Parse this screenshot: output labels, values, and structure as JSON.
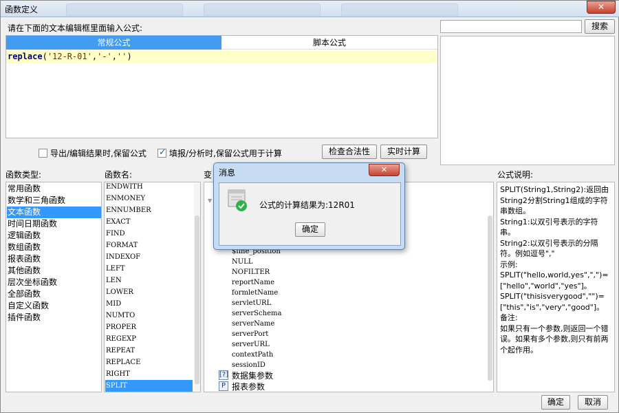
{
  "window": {
    "title": "函数定义",
    "close_glyph": "✕"
  },
  "top": {
    "prompt_label": "请在下面的文本编辑框里面输入公式:",
    "search": {
      "value": "",
      "button_label": "搜索"
    },
    "tabs": [
      {
        "label": "常规公式",
        "active": true
      },
      {
        "label": "脚本公式",
        "active": false
      }
    ],
    "formula": {
      "fn": "replace",
      "open": "(",
      "arg1": "'12-R-01'",
      "comma1": ",",
      "arg2": "'-'",
      "comma2": ",",
      "arg3": "''",
      "close": ")"
    },
    "options": [
      {
        "label": "导出/编辑结果时,保留公式",
        "checked": false
      },
      {
        "label": "填报/分析时,保留公式用于计算",
        "checked": true
      }
    ],
    "check_validity_label": "检查合法性",
    "realtime_calc_label": "实时计算"
  },
  "labels": {
    "types": "函数类型:",
    "names": "函数名:",
    "vars": "变",
    "desc": "公式说明:"
  },
  "function_types": [
    "常用函数",
    "数学和三角函数",
    "文本函数",
    "时间日期函数",
    "逻辑函数",
    "数组函数",
    "报表函数",
    "其他函数",
    "层次坐标函数",
    "全部函数",
    "自定义函数",
    "插件函数"
  ],
  "selected_type_index": 2,
  "function_names": [
    "ENDWITH",
    "ENMONEY",
    "ENNUMBER",
    "EXACT",
    "FIND",
    "FORMAT",
    "INDEXOF",
    "LEFT",
    "LEN",
    "LOWER",
    "MID",
    "NUMTO",
    "PROPER",
    "REGEXP",
    "REPEAT",
    "REPLACE",
    "RIGHT",
    "SPLIT"
  ],
  "selected_name_index": 17,
  "variables": {
    "expander_glyph": "▼",
    "partial_item": "$fine_position",
    "items": [
      "NULL",
      "NOFILTER",
      "reportName",
      "formletName",
      "servletURL",
      "serverSchema",
      "serverName",
      "serverPort",
      "serverURL",
      "contextPath",
      "sessionID"
    ],
    "groups": [
      {
        "icon_text": "[?]",
        "label": "数据集参数"
      },
      {
        "icon_text": "P",
        "label": "报表参数"
      }
    ]
  },
  "description": [
    "SPLIT(String1,String2):返回由String2分割String1组成的字符串数组。",
    "String1:以双引号表示的字符串。",
    "String2:以双引号表示的分隔符。例如逗号\",\"",
    "示例:",
    "SPLIT(\"hello,world,yes\",\",\")=[\"hello\",\"world\",\"yes\"]。",
    "SPLIT(\"thisisverygood\",\"\")=[\"this\",\"is\",\"very\",\"good\"]。",
    "备注:",
    "如果只有一个参数,则返回一个错误。如果有多个参数,则只有前两个起作用。"
  ],
  "footer": {
    "ok_label": "确定",
    "cancel_label": "取消"
  },
  "message": {
    "title": "消息",
    "close_glyph": "✕",
    "text": "公式的计算结果为:12R01",
    "ok_label": "确定"
  },
  "colors": {
    "accent": "#3399ff",
    "tab_active": "#3f9cf2",
    "formula_bg": "#ffffc8",
    "success": "#2db24a"
  }
}
